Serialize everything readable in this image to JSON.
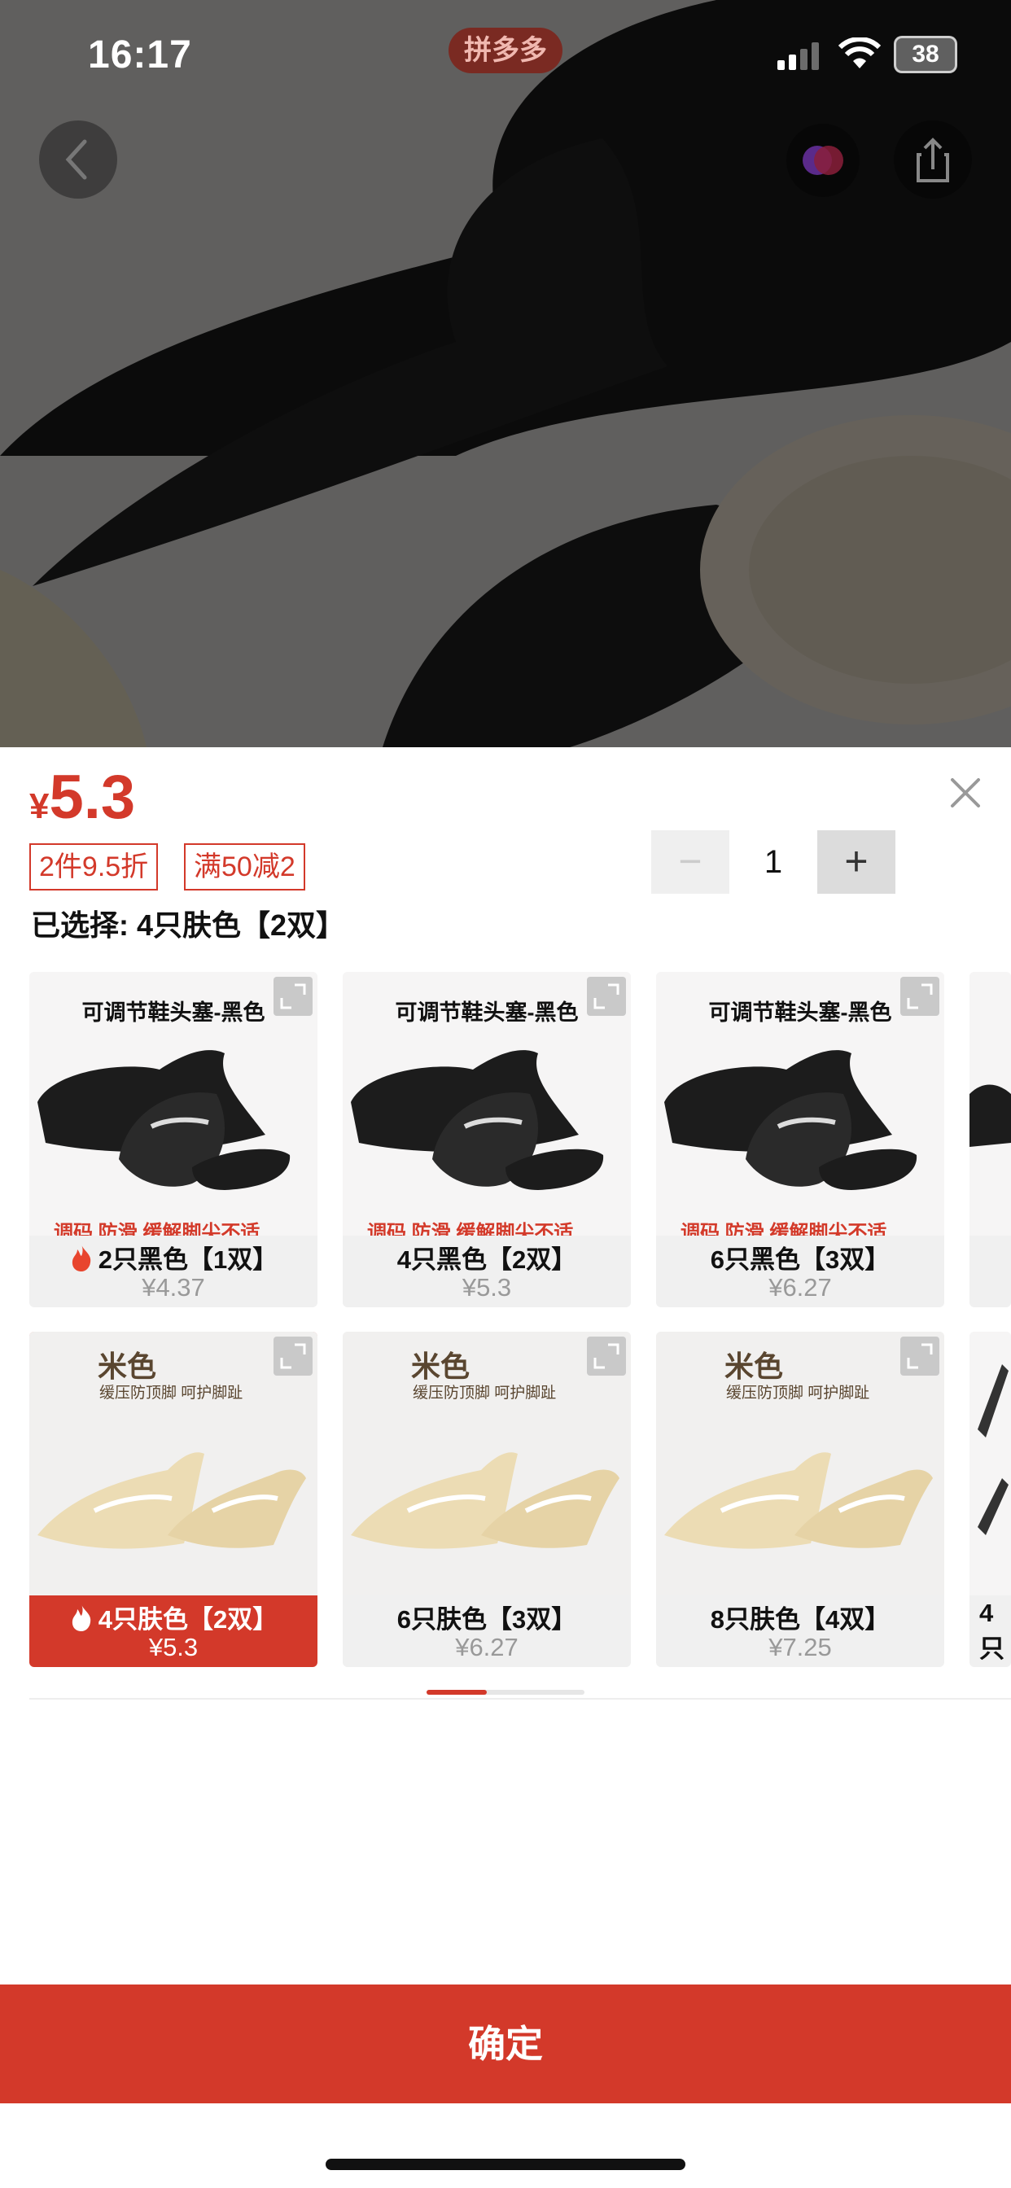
{
  "status_bar": {
    "time": "16:17",
    "app_pill": "拼多多",
    "battery": "38"
  },
  "product": {
    "currency": "¥",
    "price": "5.3",
    "promo_tags": [
      "2件9.5折",
      "满50减2"
    ],
    "selected_text": "已选择: 4只肤色【2双】",
    "quantity": "1"
  },
  "options": [
    {
      "caption": "可调节鞋头塞-黑色",
      "sub": "调码 防滑 缓解脚尖不适",
      "label": "2只黑色【1双】",
      "price": "¥4.37",
      "hot": true,
      "selected": false
    },
    {
      "caption": "可调节鞋头塞-黑色",
      "sub": "调码 防滑 缓解脚尖不适",
      "label": "4只黑色【2双】",
      "price": "¥5.3",
      "hot": false,
      "selected": false
    },
    {
      "caption": "可调节鞋头塞-黑色",
      "sub": "调码 防滑 缓解脚尖不适",
      "label": "6只黑色【3双】",
      "price": "¥6.27",
      "hot": false,
      "selected": false
    },
    {
      "caption": "米色",
      "sub": "缓压防顶脚 呵护脚趾",
      "label": "4只肤色【2双】",
      "price": "¥5.3",
      "hot": true,
      "selected": true
    },
    {
      "caption": "米色",
      "sub": "缓压防顶脚 呵护脚趾",
      "label": "6只肤色【3双】",
      "price": "¥6.27",
      "hot": false,
      "selected": false
    },
    {
      "caption": "米色",
      "sub": "缓压防顶脚 呵护脚趾",
      "label": "8只肤色【4双】",
      "price": "¥7.25",
      "hot": false,
      "selected": false
    }
  ],
  "partial_label": "4只",
  "confirm_label": "确定",
  "colors": {
    "accent": "#d3392a",
    "beige": "#ecdcb4",
    "black_product": "#1c1c1c"
  }
}
